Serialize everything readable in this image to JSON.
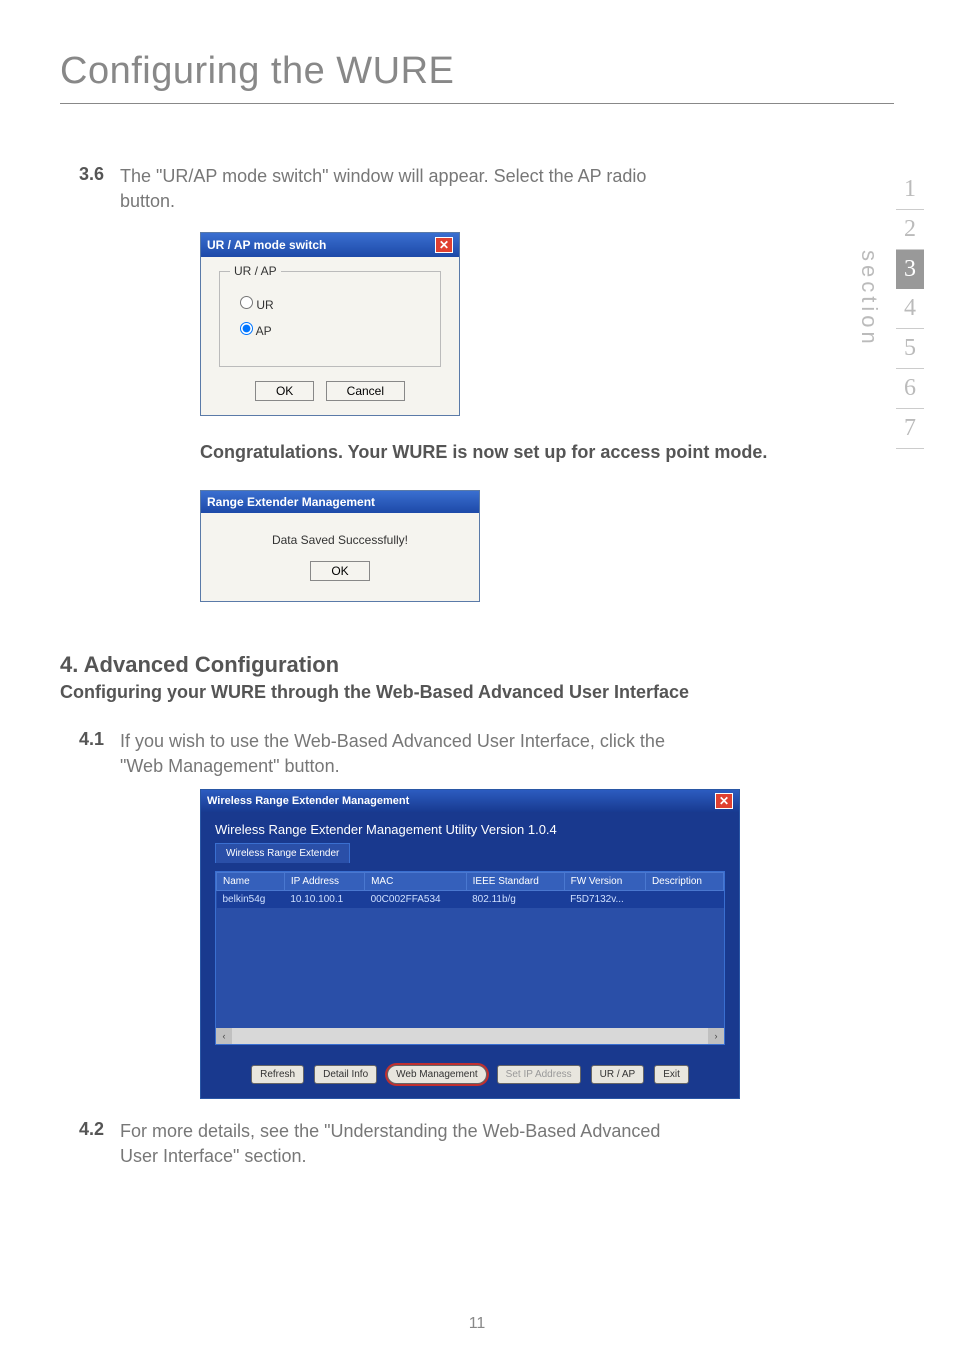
{
  "page": {
    "title": "Configuring the WURE",
    "sectionLabel": "section",
    "pageNumber": "11"
  },
  "sidenav": [
    "1",
    "2",
    "3",
    "4",
    "5",
    "6",
    "7"
  ],
  "steps": {
    "s3_6": {
      "num": "3.6",
      "text": "The \"UR/AP mode switch\" window will appear. Select the AP radio button."
    },
    "s4_1": {
      "num": "4.1",
      "text": "If you wish to use the Web-Based Advanced User Interface, click the \"Web Management\" button."
    },
    "s4_2": {
      "num": "4.2",
      "text": "For more details, see the \"Understanding the Web-Based Advanced User Interface\" section."
    }
  },
  "dialog_urap": {
    "title": "UR / AP mode switch",
    "group": "UR / AP",
    "radioUR": "UR",
    "radioAP": "AP",
    "ok": "OK",
    "cancel": "Cancel"
  },
  "congrats": "Congratulations. Your WURE is now set up for access point mode.",
  "dialog_success": {
    "title": "Range Extender Management",
    "msg": "Data Saved Successfully!",
    "ok": "OK"
  },
  "section4": {
    "heading": "4. Advanced Configuration",
    "subheading": "Configuring your WURE through the Web-Based Advanced User Interface"
  },
  "mgmt": {
    "title": "Wireless Range Extender Management",
    "subtitle": "Wireless Range Extender Management Utility Version 1.0.4",
    "tab": "Wireless Range Extender",
    "cols": {
      "name": "Name",
      "ip": "IP Address",
      "mac": "MAC",
      "ieee": "IEEE Standard",
      "fw": "FW Version",
      "desc": "Description"
    },
    "row": {
      "name": "belkin54g",
      "ip": "10.10.100.1",
      "mac": "00C002FFA534",
      "ieee": "802.11b/g",
      "fw": "F5D7132v...",
      "desc": ""
    },
    "buttons": {
      "refresh": "Refresh",
      "detail": "Detail Info",
      "web": "Web Management",
      "setip": "Set IP Address",
      "urap": "UR / AP",
      "exit": "Exit"
    },
    "scroll": {
      "left": "‹",
      "right": "›"
    }
  }
}
